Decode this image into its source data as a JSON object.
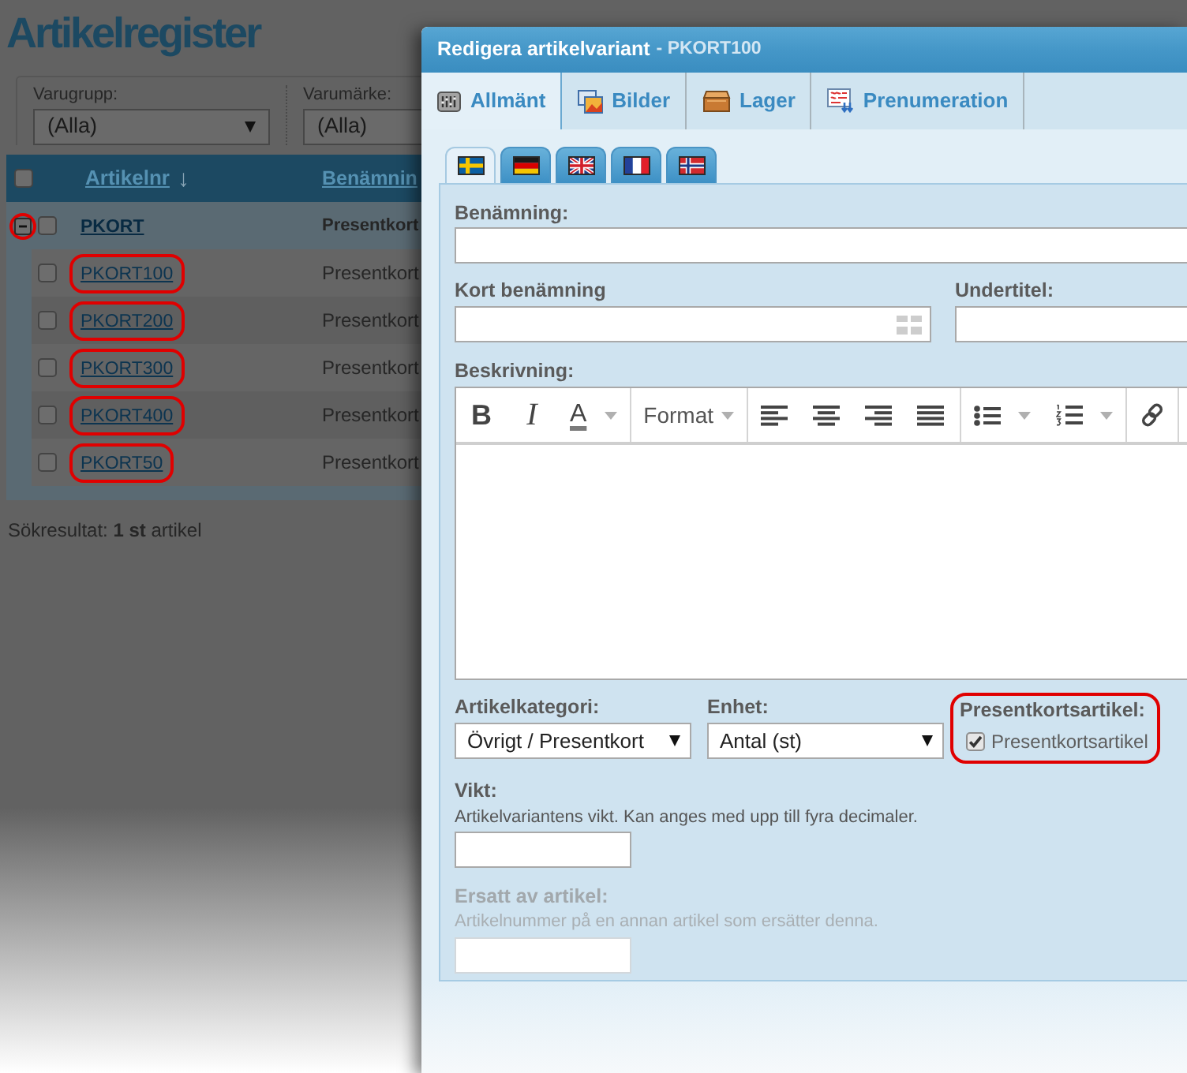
{
  "background_page": {
    "title": "Artikelregister",
    "filters": [
      {
        "label": "Varugrupp:",
        "value": "(Alla)"
      },
      {
        "label": "Varumärke:",
        "value": "(Alla)"
      }
    ],
    "table": {
      "select_all_checked": false,
      "columns": [
        {
          "label": "Artikelnr",
          "sort_arrow": "↓"
        },
        {
          "label": "Benämnin"
        }
      ],
      "rows": [
        {
          "article_no": "PKORT",
          "name": "Presentkort",
          "checked": false,
          "expanded": true,
          "toggle_highlighted": true,
          "highlighted": false,
          "children": [
            {
              "article_no": "PKORT100",
              "name": "Presentkort",
              "checked": false,
              "highlighted": true
            },
            {
              "article_no": "PKORT200",
              "name": "Presentkort",
              "checked": false,
              "highlighted": true
            },
            {
              "article_no": "PKORT300",
              "name": "Presentkort",
              "checked": false,
              "highlighted": true
            },
            {
              "article_no": "PKORT400",
              "name": "Presentkort",
              "checked": false,
              "highlighted": true
            },
            {
              "article_no": "PKORT50",
              "name": "Presentkort",
              "checked": false,
              "highlighted": true
            }
          ]
        }
      ]
    },
    "result_summary": "Sökresultat: **1 st** artikel"
  },
  "dialog": {
    "title": "Redigera artikelvariant",
    "subtitle": "- PKORT100",
    "tabs": [
      {
        "label": "Allmänt",
        "selected": true
      },
      {
        "label": "Bilder",
        "selected": false
      },
      {
        "label": "Lager",
        "selected": false
      },
      {
        "label": "Prenumeration",
        "selected": false
      }
    ],
    "languages": [
      {
        "kind": "se",
        "selected": true
      },
      {
        "kind": "de",
        "selected": false
      },
      {
        "kind": "gb",
        "selected": false
      },
      {
        "kind": "fr",
        "selected": false
      },
      {
        "kind": "no",
        "selected": false
      }
    ],
    "form": {
      "name": {
        "label": "Benämning:"
      },
      "short_name": {
        "label": "Kort benämning"
      },
      "subtitle": {
        "label": "Undertitel:"
      },
      "description": {
        "label": "Beskrivning:",
        "toolbar": [
          [
            {
              "kind": "bold",
              "label": "B",
              "dropdown": false
            },
            {
              "kind": "italic",
              "label": "I",
              "dropdown": false
            },
            {
              "kind": "text-color",
              "label": "A",
              "dropdown": true
            }
          ],
          [
            {
              "kind": "format",
              "label": "Format",
              "dropdown": true
            }
          ],
          [
            {
              "kind": "align-left",
              "dropdown": false
            },
            {
              "kind": "align-center",
              "dropdown": false
            },
            {
              "kind": "align-right",
              "dropdown": false
            },
            {
              "kind": "justify",
              "dropdown": false
            }
          ],
          [
            {
              "kind": "bulleted-list",
              "dropdown": true
            },
            {
              "kind": "numbered-list",
              "dropdown": true
            }
          ],
          [
            {
              "kind": "link",
              "dropdown": false
            }
          ]
        ]
      },
      "category": {
        "label": "Artikelkategori:",
        "value": "Övrigt / Presentkort"
      },
      "unit": {
        "label": "Enhet:",
        "value": "Antal (st)"
      },
      "gift_card": {
        "label": "Presentkortsartikel:",
        "checkbox_label": "Presentkortsartikel",
        "checked": true,
        "highlighted": true
      },
      "weight": {
        "label": "Vikt:",
        "hint": "Artikelvariantens vikt. Kan anges med upp till fyra decimaler.",
        "disabled": false
      },
      "replaced_by": {
        "label": "Ersatt av artikel:",
        "hint": "Artikelnummer på en annan artikel som ersätter denna.",
        "disabled": true
      }
    }
  }
}
